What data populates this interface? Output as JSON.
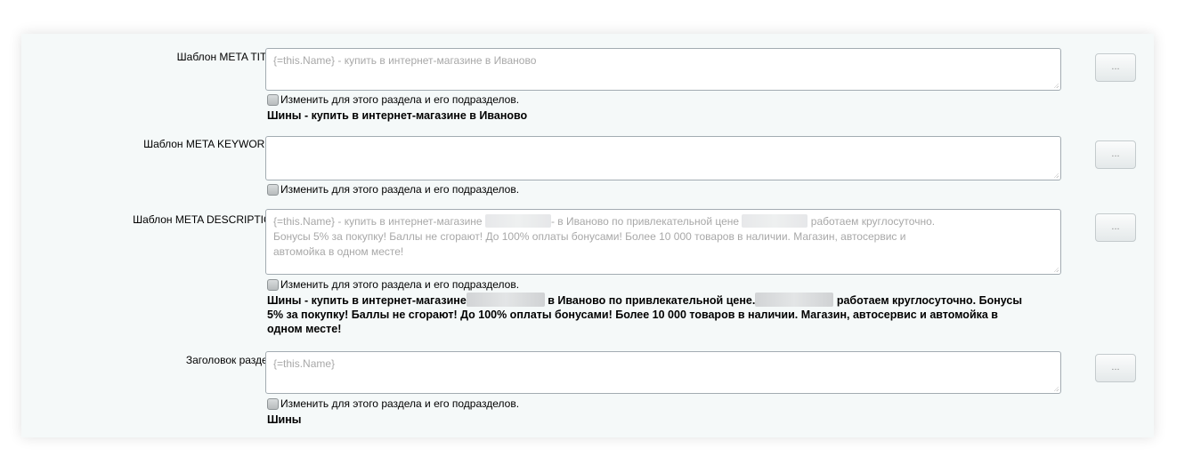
{
  "fields": {
    "title": {
      "label": "Шаблон META TITLE",
      "value": "{=this.Name} - купить в интернет-магазине в Иваново",
      "checkbox": "Изменить для этого раздела и его подразделов.",
      "preview": "Шины - купить в интернет-магазине в Иваново",
      "button": "..."
    },
    "keywords": {
      "label": "Шаблон META KEYWORDS",
      "value": "",
      "checkbox": "Изменить для этого раздела и его подразделов.",
      "button": "..."
    },
    "description": {
      "label": "Шаблон META DESCRIPTION",
      "value_part1": "{=this.Name} - купить в интернет-магазине",
      "value_part2": "- в Иваново по привлекательной цене",
      "value_part3": "работаем круглосуточно.",
      "value_line2": "Бонусы 5% за покупку! Баллы не сгорают! До 100% оплаты бонусами! Более 10 000 товаров в наличии. Магазин, автосервис и",
      "value_line3": "автомойка в одном месте!",
      "checkbox": "Изменить для этого раздела и его подразделов.",
      "preview_part1": "Шины - купить в интернет-магазине",
      "preview_part2": "в Иваново по привлекательной цене.",
      "preview_part3": "работаем круглосуточно. Бонусы",
      "preview_line2": "5% за покупку! Баллы не сгорают! До 100% оплаты бонусами! Более 10 000 товаров в наличии. Магазин, автосервис и автомойка в",
      "preview_line3": "одном месте!",
      "button": "..."
    },
    "heading": {
      "label": "Заголовок раздела",
      "value": "{=this.Name}",
      "checkbox": "Изменить для этого раздела и его подразделов.",
      "preview": "Шины",
      "button": "..."
    }
  }
}
